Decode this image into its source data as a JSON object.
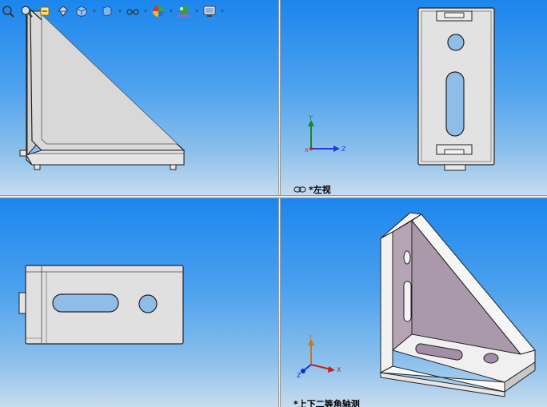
{
  "app": {
    "mode": "four-viewport"
  },
  "toolbar": {
    "icons": [
      "zoom-to-fit-icon",
      "zoom-area-icon",
      "previous-view-icon",
      "section-view-icon",
      "view-orientation-icon",
      "display-style-icon",
      "hide-show-items-icon",
      "edit-appearance-icon",
      "apply-scene-icon",
      "view-settings-icon"
    ]
  },
  "viewports": {
    "top_left": {
      "label": ""
    },
    "top_right": {
      "label": "*左视"
    },
    "bottom_left": {
      "label": ""
    },
    "bottom_right": {
      "label": "*上下二等角轴测"
    }
  },
  "triads": {
    "top_right": {
      "x": "Z",
      "y": "Y",
      "z": "X"
    },
    "bottom_right": {
      "x": "X",
      "y": "Y",
      "z": "Z"
    }
  },
  "colors": {
    "viewport_top": "#1b86ee",
    "viewport_bottom": "#c7dcee",
    "part_face": "#dedede",
    "part_shade": "#b8a8b8",
    "part_edge": "#222222"
  }
}
